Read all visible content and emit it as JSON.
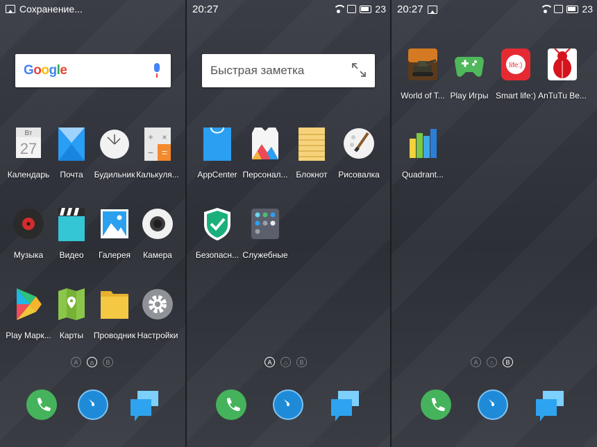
{
  "screen1": {
    "status_text": "Сохранение...",
    "search_logo": "Google",
    "apps": [
      {
        "label": "Календарь",
        "cal_day": "Вт",
        "cal_date": "27"
      },
      {
        "label": "Почта"
      },
      {
        "label": "Будильник"
      },
      {
        "label": "Калькуля..."
      },
      {
        "label": "Музыка"
      },
      {
        "label": "Видео"
      },
      {
        "label": "Галерея"
      },
      {
        "label": "Камера"
      },
      {
        "label": "Play Марк..."
      },
      {
        "label": "Карты"
      },
      {
        "label": "Проводник"
      },
      {
        "label": "Настройки"
      }
    ],
    "pager": [
      "A",
      "⌂",
      "B"
    ],
    "pager_active": 1
  },
  "screen2": {
    "time": "20:27",
    "battery_text": "23",
    "note_placeholder": "Быстрая заметка",
    "apps": [
      {
        "label": "AppCenter"
      },
      {
        "label": "Персонал..."
      },
      {
        "label": "Блокнот"
      },
      {
        "label": "Рисовалка"
      },
      {
        "label": "Безопасн..."
      },
      {
        "label": "Служебные"
      }
    ],
    "pager": [
      "A",
      "⌂",
      "B"
    ],
    "pager_active": 0
  },
  "screen3": {
    "time": "20:27",
    "battery_text": "23",
    "apps": [
      {
        "label": "World of T..."
      },
      {
        "label": "Play Игры"
      },
      {
        "label": "Smart life:)",
        "icon_text": "life:)"
      },
      {
        "label": "AnTuTu Be..."
      },
      {
        "label": "Quadrant..."
      }
    ],
    "pager": [
      "A",
      "⌂",
      "B"
    ],
    "pager_active": 2
  },
  "colors": {
    "phone": "#45b35b",
    "browser": "#1f8bd8",
    "messages": "#2ea4f0"
  }
}
